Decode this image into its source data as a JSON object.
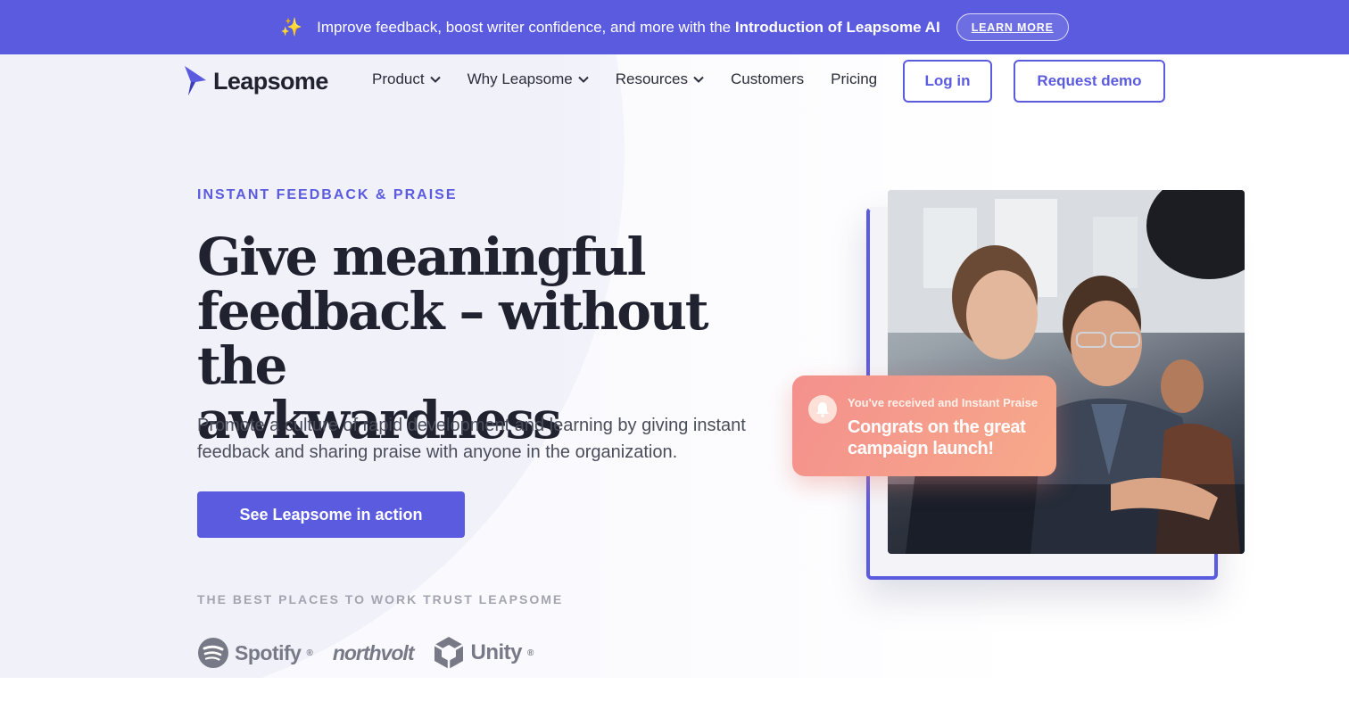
{
  "announcement": {
    "sparkle": "✨",
    "text_prefix": "Improve feedback, boost writer confidence, and more with the ",
    "text_bold": "Introduction of Leapsome AI",
    "learn_more": "LEARN MORE"
  },
  "nav": {
    "logo_text": "Leapsome",
    "items": [
      {
        "label": "Product",
        "has_dropdown": true
      },
      {
        "label": "Why Leapsome",
        "has_dropdown": true
      },
      {
        "label": "Resources",
        "has_dropdown": true
      },
      {
        "label": "Customers",
        "has_dropdown": false
      },
      {
        "label": "Pricing",
        "has_dropdown": false
      }
    ],
    "login": "Log in",
    "demo": "Request demo"
  },
  "hero": {
    "eyebrow": "INSTANT FEEDBACK & PRAISE",
    "headline_lines": [
      "Give meaningful",
      "feedback – without the",
      "awkwardness"
    ],
    "subtext": "Promote a culture of rapid development and learning by giving instant feedback and sharing praise with anyone in the organization.",
    "cta": "See Leapsome in action",
    "trust_heading": "THE BEST PLACES TO WORK TRUST LEAPSOME",
    "logos": [
      "Spotify",
      "northvolt",
      "Unity"
    ]
  },
  "praise_card": {
    "small": "You've received and Instant Praise",
    "big": "Congrats on the great campaign launch!"
  },
  "colors": {
    "brand": "#5b5be0",
    "heading": "#20232f",
    "praise_start": "#f4908d",
    "praise_end": "#f7a98a"
  },
  "icons": {
    "announcement": "sparkle-icon",
    "dropdown": "chevron-down-icon",
    "praise": "bell-icon",
    "logo": "leapsome-bird-icon"
  }
}
